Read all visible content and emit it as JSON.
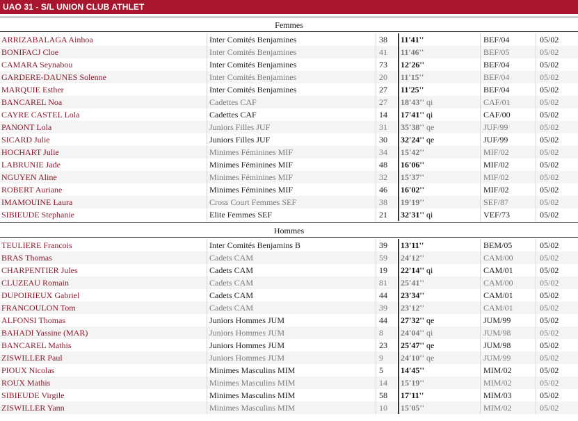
{
  "header": {
    "title": "UAO 31 - S/L UNION CLUB ATHLET"
  },
  "sections": [
    {
      "title": "Femmes",
      "rows": [
        {
          "name": "ARRIZABALAGA Ainhoa",
          "category": "Inter Comités Benjamines",
          "place": "38",
          "time": "11'41''",
          "qual": "",
          "code": "BEF/04",
          "date": "05/02"
        },
        {
          "name": "BONIFACJ Cloe",
          "category": "Inter Comités Benjamines",
          "place": "41",
          "time": "11'46''",
          "qual": "",
          "code": "BEF/05",
          "date": "05/02"
        },
        {
          "name": "CAMARA Seynabou",
          "category": "Inter Comités Benjamines",
          "place": "73",
          "time": "12'26''",
          "qual": "",
          "code": "BEF/04",
          "date": "05/02"
        },
        {
          "name": "GARDERE-DAUNES Solenne",
          "category": "Inter Comités Benjamines",
          "place": "20",
          "time": "11'15''",
          "qual": "",
          "code": "BEF/04",
          "date": "05/02"
        },
        {
          "name": "MARQUIE Esther",
          "category": "Inter Comités Benjamines",
          "place": "27",
          "time": "11'25''",
          "qual": "",
          "code": "BEF/04",
          "date": "05/02"
        },
        {
          "name": "BANCAREL Noa",
          "category": "Cadettes CAF",
          "place": "27",
          "time": "18'43''",
          "qual": "qi",
          "code": "CAF/01",
          "date": "05/02"
        },
        {
          "name": "CAYRE CASTEL Lola",
          "category": "Cadettes CAF",
          "place": "14",
          "time": "17'41''",
          "qual": "qi",
          "code": "CAF/00",
          "date": "05/02"
        },
        {
          "name": "PANONT Lola",
          "category": "Juniors Filles JUF",
          "place": "31",
          "time": "35'38''",
          "qual": "qe",
          "code": "JUF/99",
          "date": "05/02"
        },
        {
          "name": "SICARD Julie",
          "category": "Juniors Filles JUF",
          "place": "30",
          "time": "32'24''",
          "qual": "qe",
          "code": "JUF/99",
          "date": "05/02"
        },
        {
          "name": "HOCHART Julie",
          "category": "Minimes Féminines MIF",
          "place": "34",
          "time": "15'42''",
          "qual": "",
          "code": "MIF/02",
          "date": "05/02"
        },
        {
          "name": "LABRUNIE Jade",
          "category": "Minimes Féminines MIF",
          "place": "48",
          "time": "16'06''",
          "qual": "",
          "code": "MIF/02",
          "date": "05/02"
        },
        {
          "name": "NGUYEN Aline",
          "category": "Minimes Féminines MIF",
          "place": "32",
          "time": "15'37''",
          "qual": "",
          "code": "MIF/02",
          "date": "05/02"
        },
        {
          "name": "ROBERT Auriane",
          "category": "Minimes Féminines MIF",
          "place": "46",
          "time": "16'02''",
          "qual": "",
          "code": "MIF/02",
          "date": "05/02"
        },
        {
          "name": "IMAMOUINE Laura",
          "category": "Cross Court Femmes SEF",
          "place": "38",
          "time": "19'19''",
          "qual": "",
          "code": "SEF/87",
          "date": "05/02"
        },
        {
          "name": "SIBIEUDE Stephanie",
          "category": "Elite Femmes SEF",
          "place": "21",
          "time": "32'31''",
          "qual": "qi",
          "code": "VEF/73",
          "date": "05/02"
        }
      ]
    },
    {
      "title": "Hommes",
      "rows": [
        {
          "name": "TEULIERE Francois",
          "category": "Inter Comités Benjamins B",
          "place": "39",
          "time": "13'11''",
          "qual": "",
          "code": "BEM/05",
          "date": "05/02"
        },
        {
          "name": "BRAS Thomas",
          "category": "Cadets CAM",
          "place": "59",
          "time": "24'12''",
          "qual": "",
          "code": "CAM/00",
          "date": "05/02"
        },
        {
          "name": "CHARPENTIER Jules",
          "category": "Cadets CAM",
          "place": "19",
          "time": "22'14''",
          "qual": "qi",
          "code": "CAM/01",
          "date": "05/02"
        },
        {
          "name": "CLUZEAU Romain",
          "category": "Cadets CAM",
          "place": "81",
          "time": "25'41''",
          "qual": "",
          "code": "CAM/00",
          "date": "05/02"
        },
        {
          "name": "DUPOIRIEUX Gabriel",
          "category": "Cadets CAM",
          "place": "44",
          "time": "23'34''",
          "qual": "",
          "code": "CAM/01",
          "date": "05/02"
        },
        {
          "name": "FRANCOULON Tom",
          "category": "Cadets CAM",
          "place": "39",
          "time": "23'12''",
          "qual": "",
          "code": "CAM/01",
          "date": "05/02"
        },
        {
          "name": "ALFONSI Thomas",
          "category": "Juniors Hommes JUM",
          "place": "44",
          "time": "27'32''",
          "qual": "qe",
          "code": "JUM/99",
          "date": "05/02"
        },
        {
          "name": "BAHADI Yassine (MAR)",
          "category": "Juniors Hommes JUM",
          "place": "8",
          "time": "24'04''",
          "qual": "qi",
          "code": "JUM/98",
          "date": "05/02"
        },
        {
          "name": "BANCAREL Mathis",
          "category": "Juniors Hommes JUM",
          "place": "23",
          "time": "25'47''",
          "qual": "qe",
          "code": "JUM/98",
          "date": "05/02"
        },
        {
          "name": "ZISWILLER Paul",
          "category": "Juniors Hommes JUM",
          "place": "9",
          "time": "24'10''",
          "qual": "qe",
          "code": "JUM/99",
          "date": "05/02"
        },
        {
          "name": "PIOUX Nicolas",
          "category": "Minimes Masculins MIM",
          "place": "5",
          "time": "14'45''",
          "qual": "",
          "code": "MIM/02",
          "date": "05/02"
        },
        {
          "name": "ROUX Mathis",
          "category": "Minimes Masculins MIM",
          "place": "14",
          "time": "15'19''",
          "qual": "",
          "code": "MIM/02",
          "date": "05/02"
        },
        {
          "name": "SIBIEUDE Virgile",
          "category": "Minimes Masculins MIM",
          "place": "58",
          "time": "17'11''",
          "qual": "",
          "code": "MIM/03",
          "date": "05/02"
        },
        {
          "name": "ZISWILLER Yann",
          "category": "Minimes Masculins MIM",
          "place": "10",
          "time": "15'05''",
          "qual": "",
          "code": "MIM/02",
          "date": "05/02"
        }
      ]
    }
  ]
}
